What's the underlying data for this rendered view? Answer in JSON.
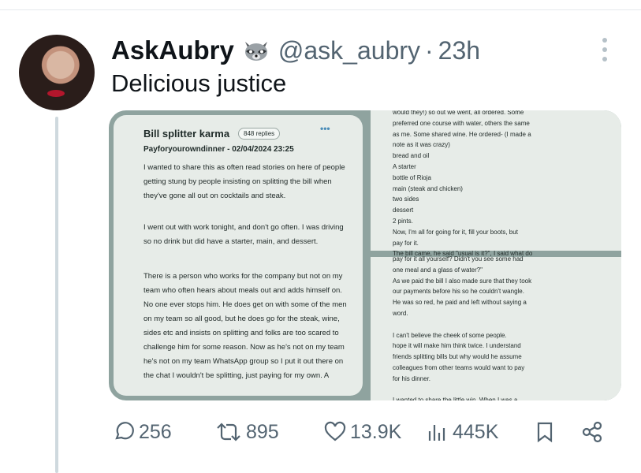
{
  "tweet": {
    "display_name": "AskAubry",
    "emoji": "raccoon-icon",
    "handle": "@ask_aubry",
    "separator": "·",
    "time": "23h",
    "text": "Delicious justice"
  },
  "screenshot": {
    "title": "Bill splitter karma",
    "replies_badge": "848 replies",
    "more": "•••",
    "meta": "Payforyourowndinner - 02/04/2024 23:25",
    "left_paragraphs": [
      "I wanted to share this as often read stories on here of people getting stung by people insisting on splitting the bill when they've gone all out on cocktails and steak.",
      "I went out with work tonight, and don't go often. I was driving so no drink but did have a starter, main, and dessert.",
      "There is a person who works for the company but not on my team who often hears about meals out and adds himself on. No one ever stops him. He does get on with some of the men on my team so all good, but he does go for the steak, wine, sides etc and insists on splitting and folks are too scared to challenge him for some reason. Now as he's not on my team he's not on my team WhatsApp group so I put it out there on the chat I wouldn't be splitting, just paying for my own. A"
    ],
    "right_top_lines": [
      "would they!) so out we went, all ordered. Some",
      "preferred one course with water, others the same",
      "as me. Some shared wine. He ordered- (I made a",
      "note as it was crazy)",
      "bread and oil",
      "A starter",
      "bottle of Rioja",
      "main (steak and chicken)",
      "two sides",
      "dessert",
      "2 pints.",
      "Now, I'm all for going for it, fill your boots, but",
      "pay for it.",
      "The bill came, he said \"usual is it?\", I said what do"
    ],
    "right_bottom_lines": [
      "pay for it all yourself? Didn't you see some had",
      "one meal and a glass of water?\"",
      "As we paid the bill I also made sure that they took",
      "our payments before his so he couldn't wangle.",
      "He was so red, he paid and left without saying a",
      "word.",
      "",
      "I can't believe the cheek of some people.",
      "hope it will make him think twice. I understand",
      "friends splitting bills but why would he assume",
      "colleagues from other teams would want to pay",
      "for his dinner.",
      "",
      "I wanted to share the little win. When I was a"
    ]
  },
  "actions": {
    "replies": "256",
    "reposts": "895",
    "likes": "13.9K",
    "views": "445K"
  },
  "colors": {
    "text": "#0f1419",
    "secondary": "#536471",
    "thread": "#cfd9de",
    "card_bg": "#e7ece8",
    "media_bg": "#8fa39f"
  }
}
